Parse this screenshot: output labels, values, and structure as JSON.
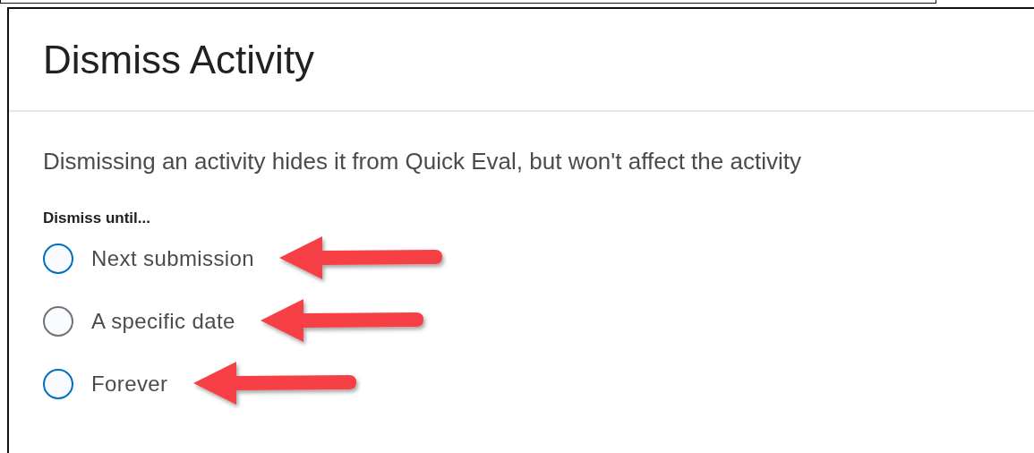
{
  "dialog": {
    "title": "Dismiss Activity",
    "description": "Dismissing an activity hides it from Quick Eval, but won't affect the activity",
    "group_label": "Dismiss until...",
    "options": [
      {
        "label": "Next submission",
        "selected": false,
        "color": "#006fbf",
        "arrow": true
      },
      {
        "label": "A specific date",
        "selected": false,
        "color": "#6e7376",
        "arrow": true
      },
      {
        "label": "Forever",
        "selected": false,
        "color": "#006fbf",
        "arrow": true
      }
    ]
  }
}
